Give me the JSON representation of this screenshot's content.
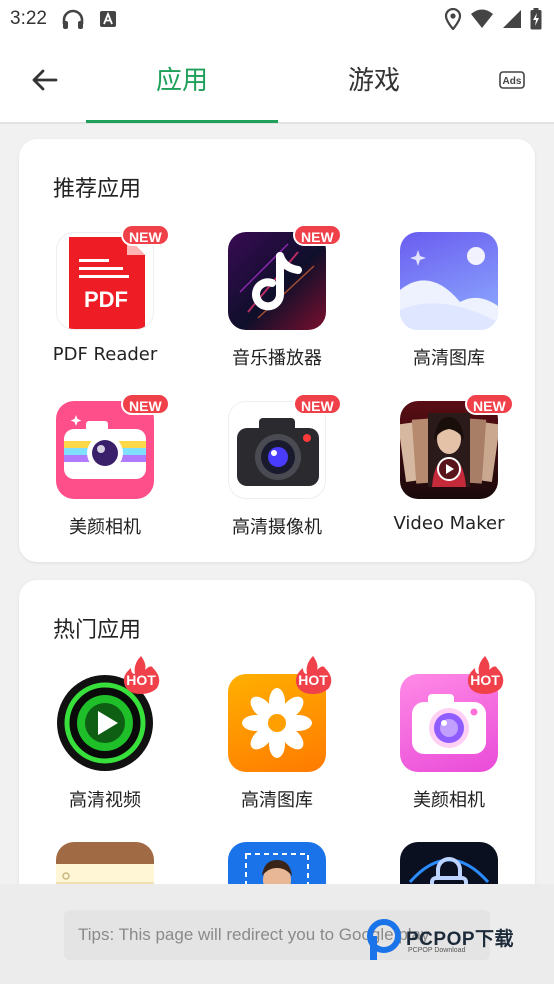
{
  "status_bar": {
    "time": "3:22"
  },
  "app_bar": {
    "tabs": [
      {
        "label": "应用",
        "active": true
      },
      {
        "label": "游戏",
        "active": false
      }
    ],
    "ads_label": "Ads"
  },
  "recommended": {
    "title": "推荐应用",
    "apps": [
      {
        "name": "PDF Reader",
        "badge": "NEW"
      },
      {
        "name": "音乐播放器",
        "badge": "NEW"
      },
      {
        "name": "高清图库",
        "badge": ""
      },
      {
        "name": "美颜相机",
        "badge": "NEW"
      },
      {
        "name": "高清摄像机",
        "badge": "NEW"
      },
      {
        "name": "Video Maker",
        "badge": "NEW"
      }
    ]
  },
  "hot": {
    "title": "热门应用",
    "apps": [
      {
        "name": "高清视频",
        "badge": "HOT"
      },
      {
        "name": "高清图库",
        "badge": "HOT"
      },
      {
        "name": "美颜相机",
        "badge": "HOT"
      }
    ]
  },
  "tips": "Tips: This page will redirect you to Google play",
  "watermark": {
    "brand": "PCPOP下载",
    "sub": "PCPOP Download"
  },
  "colors": {
    "accent": "#1ea05a",
    "badge": "#f0404a"
  }
}
